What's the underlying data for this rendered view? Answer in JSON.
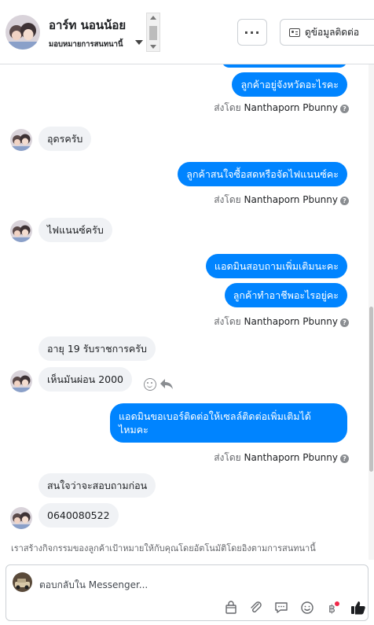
{
  "header": {
    "name": "อาร์ท นอนน้อย",
    "subtitle": "มอบหมายการสนทนานี้",
    "more_label": "···",
    "contact_label": "ดูข้อมูลติดต่อ"
  },
  "messages": {
    "out1": "ลูกค้าอยู่จังหวัดอะไรคะ",
    "sent_by_prefix": "ส่งโดย",
    "sent_by_name": "Nanthaporn Pbunny",
    "in1": "อุดรครับ",
    "out2": "ลูกค้าสนใจซื้อสดหรือจัดไฟแนนซ์คะ",
    "in2": "ไฟแนนซ์ครับ",
    "out3": "แอดมินสอบถามเพิ่มเติมนะคะ",
    "out4": "ลูกค้าทำอาชีพอะไรอยู่คะ",
    "in3": "อายุ 19  รับราชการครับ",
    "in4": "เห็นมันผ่อน 2000",
    "out5_line1": "แอดมินขอเบอร์ติดต่อให้เซลล์ติดต่อเพิ่มเติมได้",
    "out5_line2": "ไหมคะ",
    "in5": "สนใจว่าจะสอบถามก่อน",
    "in6": "0640080522",
    "question_mark": "?"
  },
  "footnote": "เราสร้างกิจกรรมของลูกค้าเป้าหมายให้กับคุณโดยอัตโนมัติโดยอิงตามการสนทนานี้",
  "composer": {
    "placeholder": "ตอบกลับใน Messenger..."
  },
  "icons": [
    "more-icon",
    "contact-card-icon",
    "help-icon",
    "smile-icon",
    "reply-icon",
    "bag-icon",
    "attach-icon",
    "saved-reply-icon",
    "emoji-icon",
    "baht-icon",
    "like-icon"
  ],
  "colors": {
    "accent": "#0084ff",
    "incoming": "#f0f2f5",
    "like": "#1c1e21",
    "notify_dot": "#f02849"
  }
}
